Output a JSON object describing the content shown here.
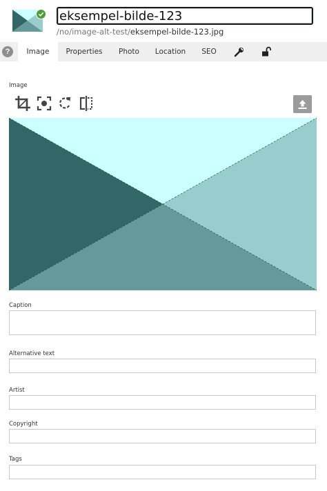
{
  "header": {
    "title_value": "eksempel-bilde-123",
    "path_prefix": "/no/image-alt-test/",
    "path_file": "eksempel-bilde-123.jpg"
  },
  "tabs": {
    "help_label": "?",
    "image": "Image",
    "properties": "Properties",
    "photo": "Photo",
    "location": "Location",
    "seo": "SEO",
    "icons": [
      "wrench-icon",
      "unlock-icon"
    ]
  },
  "image_section": {
    "label": "Image",
    "tools": [
      "crop-icon",
      "focus-icon",
      "rotate-icon",
      "flip-icon"
    ],
    "upload_icon": "upload-icon"
  },
  "fields": {
    "caption": {
      "label": "Caption",
      "value": ""
    },
    "alt_text": {
      "label": "Alternative text",
      "value": ""
    },
    "artist": {
      "label": "Artist",
      "value": ""
    },
    "copyright": {
      "label": "Copyright",
      "value": ""
    },
    "tags": {
      "label": "Tags",
      "value": ""
    }
  },
  "colors": {
    "accent_green": "#4f9e3a",
    "image_light": "#ccffff",
    "image_dark": "#336666",
    "image_mid": "#669999",
    "image_soft": "#99cccc"
  }
}
